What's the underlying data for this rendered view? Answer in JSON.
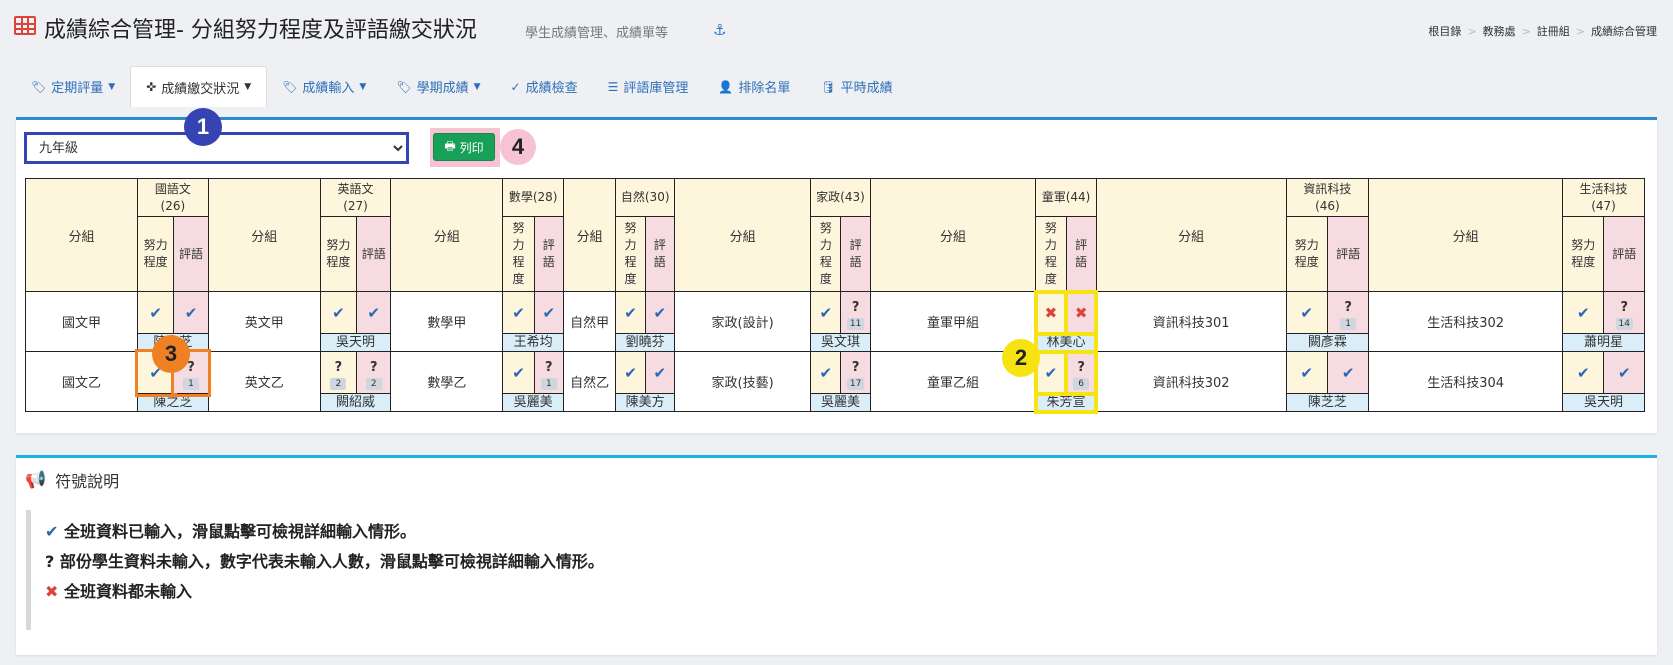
{
  "header": {
    "title": "成績綜合管理- 分組努力程度及評語繳交狀況",
    "subtitle": "學生成績管理、成績單等",
    "breadcrumb": [
      "根目錄",
      "教務處",
      "註冊組",
      "成績綜合管理"
    ]
  },
  "tabs": [
    {
      "label": "定期評量",
      "icon": "tag-icon",
      "dropdown": true
    },
    {
      "label": "成績繳交狀況",
      "icon": "crosshairs-icon",
      "dropdown": true,
      "active": true
    },
    {
      "label": "成績輸入",
      "icon": "tag-icon",
      "dropdown": true
    },
    {
      "label": "學期成績",
      "icon": "tag-icon",
      "dropdown": true
    },
    {
      "label": "成績檢查",
      "icon": "check-circle-icon",
      "dropdown": false
    },
    {
      "label": "評語庫管理",
      "icon": "list-icon",
      "dropdown": false
    },
    {
      "label": "排除名單",
      "icon": "user-times-icon",
      "dropdown": false
    },
    {
      "label": "平時成績",
      "icon": "database-icon",
      "dropdown": false
    }
  ],
  "toolbar": {
    "grade_select": "九年級",
    "print_label": "列印"
  },
  "badges": [
    "1",
    "2",
    "3",
    "4"
  ],
  "grid": {
    "group_header": "分組",
    "effort_label": "努力程度",
    "comment_label": "評語",
    "subjects": [
      {
        "name": "國語文",
        "code": "(26)"
      },
      {
        "name": "英語文",
        "code": "(27)"
      },
      {
        "name": "數學",
        "code": "(28)"
      },
      {
        "name": "自然",
        "code": "(30)"
      },
      {
        "name": "家政",
        "code": "(43)"
      },
      {
        "name": "童軍",
        "code": "(44)"
      },
      {
        "name": "資訊科技",
        "code": "(46)"
      },
      {
        "name": "生活科技",
        "code": "(47)"
      }
    ],
    "rows": [
      {
        "groups": [
          "國文甲",
          "英文甲",
          "數學甲",
          "自然甲",
          "家政(設計)",
          "童軍甲組",
          "資訊科技301",
          "生活科技302"
        ],
        "teachers": [
          "陳之芝",
          "吳天明",
          "王希均",
          "劉曉芬",
          "吳文琪",
          "林美心",
          "闕彥霖",
          "蕭明星"
        ],
        "marks": [
          [
            "check",
            "check"
          ],
          [
            "check",
            "check"
          ],
          [
            "check",
            "check"
          ],
          [
            "check",
            "check"
          ],
          [
            "check",
            "?11"
          ],
          [
            "cross",
            "cross"
          ],
          [
            "check",
            "?1"
          ],
          [
            "check",
            "?14"
          ]
        ]
      },
      {
        "groups": [
          "國文乙",
          "英文乙",
          "數學乙",
          "自然乙",
          "家政(技藝)",
          "童軍乙組",
          "資訊科技302",
          "生活科技304"
        ],
        "teachers": [
          "陳之芝",
          "闕紹威",
          "吳麗美",
          "陳美方",
          "吳麗美",
          "朱芳宣",
          "陳芝芝",
          "吳天明"
        ],
        "marks": [
          [
            "check",
            "?1"
          ],
          [
            "?2",
            "?2"
          ],
          [
            "check",
            "?1"
          ],
          [
            "check",
            "check"
          ],
          [
            "check",
            "?17"
          ],
          [
            "check",
            "?6"
          ],
          [
            "check",
            "check"
          ],
          [
            "check",
            "check"
          ]
        ]
      }
    ]
  },
  "legend": {
    "title": "符號說明",
    "items": [
      {
        "symbol": "✔",
        "text": "全班資料已輸入，滑鼠點擊可檢視詳細輸入情形。"
      },
      {
        "symbol": "?",
        "text": "部份學生資料未輸入，數字代表未輸入人數，滑鼠點擊可檢視詳細輸入情形。"
      },
      {
        "symbol": "✖",
        "text": "全班資料都未輸入"
      }
    ]
  },
  "colors": {
    "accent_blue": "#2f8bd0",
    "print_green": "#18a058",
    "check_blue": "#2b68b3",
    "cross_red": "#d9453b",
    "badge1": "#3643b3",
    "badge2": "#f7e312",
    "badge3": "#f08024",
    "badge4": "#f7c2d3"
  }
}
